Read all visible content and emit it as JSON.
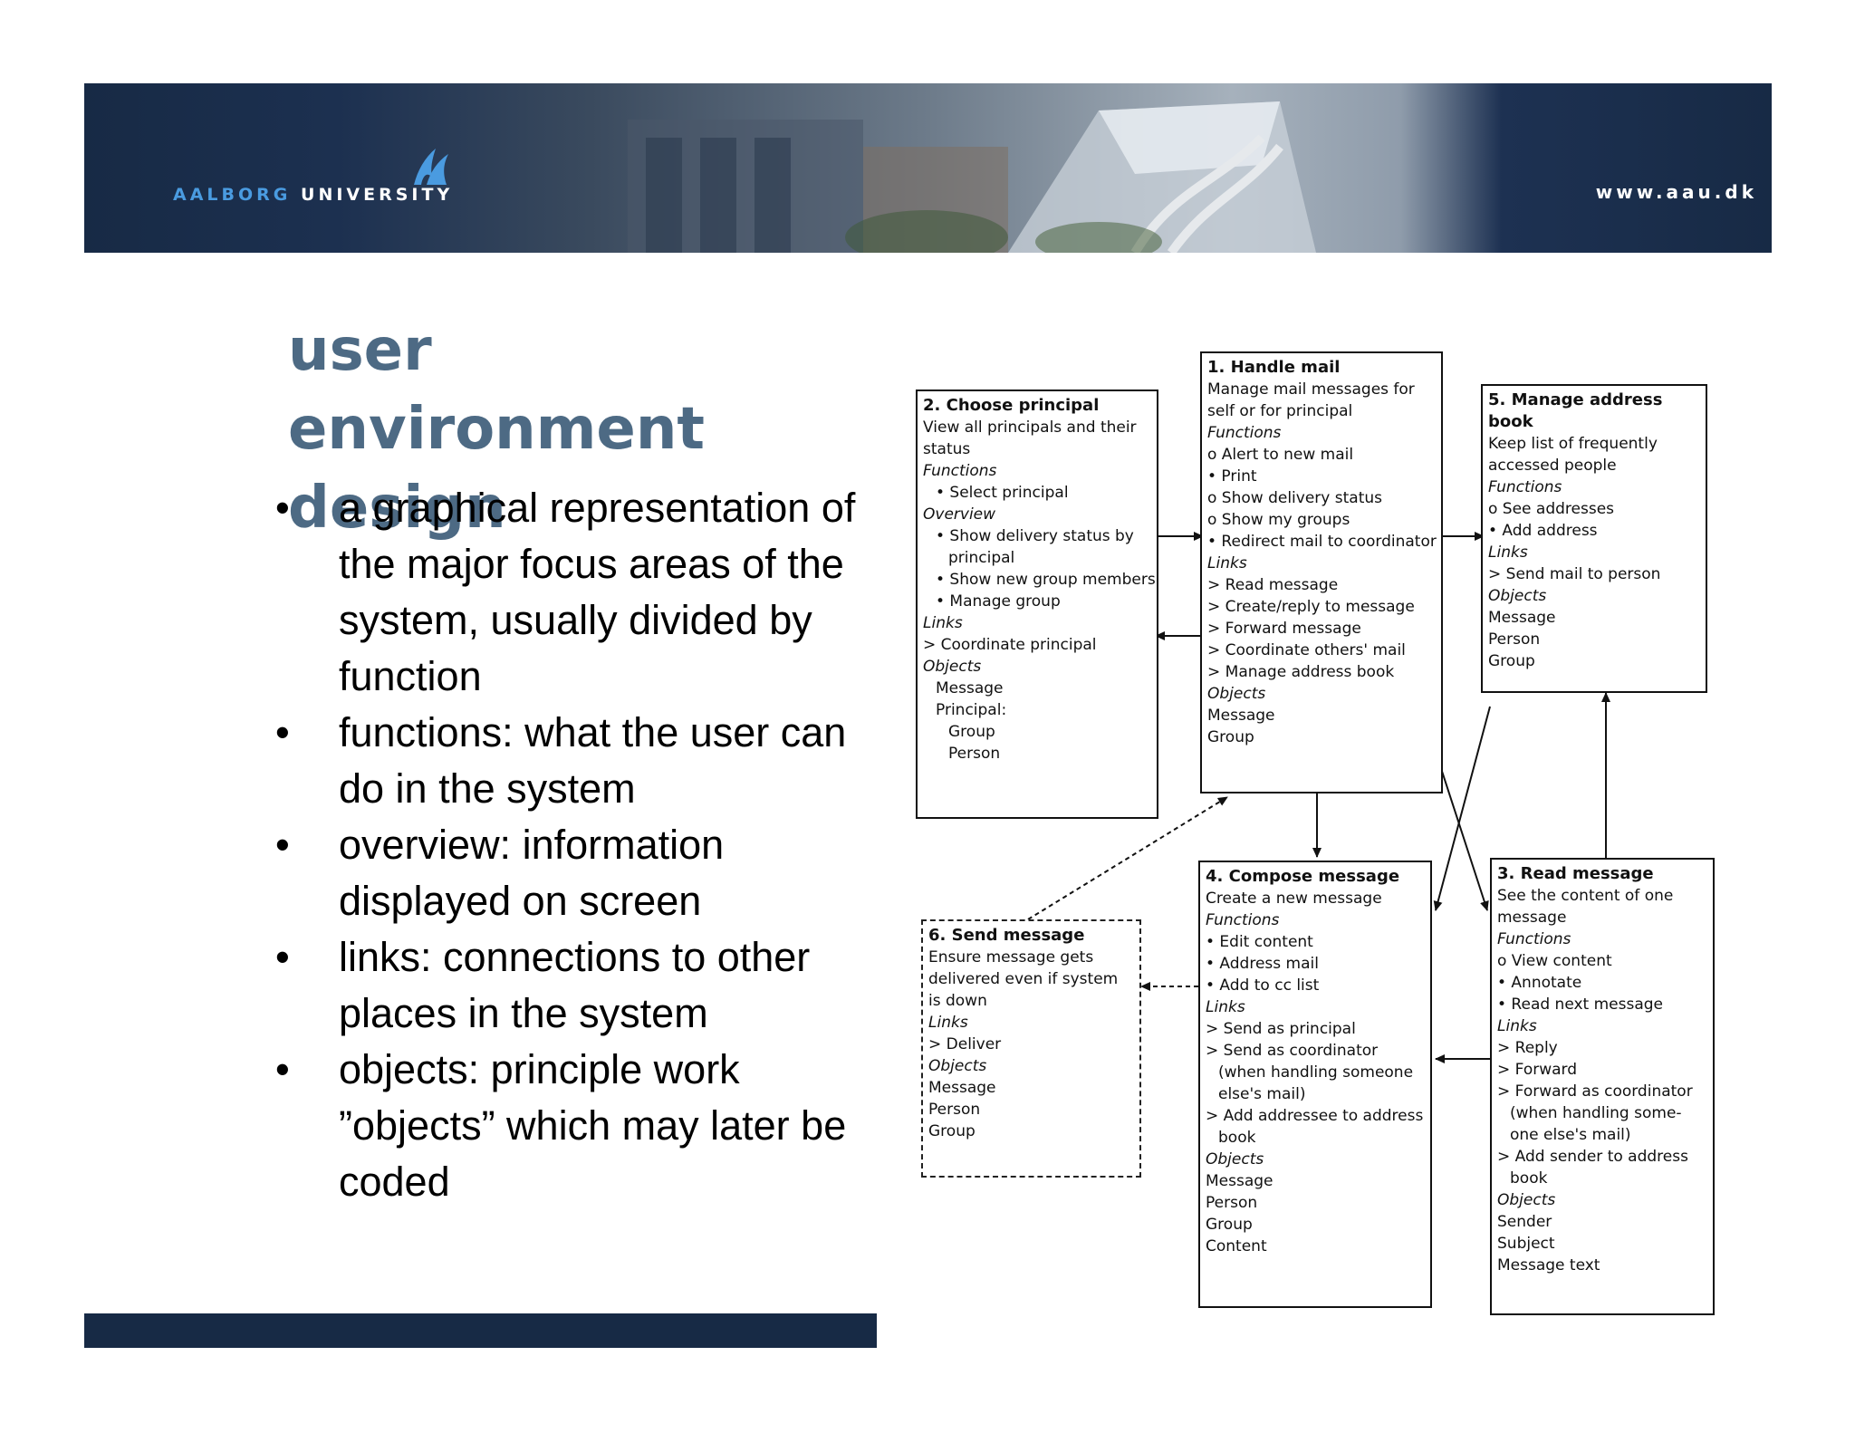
{
  "header": {
    "logo_part1": "AALBORG",
    "logo_part2": "UNIVERSITY",
    "url": "www.aau.dk"
  },
  "slide": {
    "title": "user environment design",
    "bullets": [
      "a graphical representation of the major focus areas of the system, usually divided by function",
      "functions: what the user can do in the system",
      "overview:  information displayed on screen",
      "links: connections to other places in the system",
      "objects: principle work ”objects” which may later be coded"
    ]
  },
  "diagram": {
    "boxes": [
      {
        "title": "2. Choose principal",
        "lines": [
          {
            "t": "View all principals and their"
          },
          {
            "t": "status"
          },
          {
            "t": "Functions",
            "s": "sec"
          },
          {
            "t": "• Select principal",
            "s": "ind"
          },
          {
            "t": "Overview",
            "s": "sec"
          },
          {
            "t": "• Show delivery status by",
            "s": "ind"
          },
          {
            "t": "principal",
            "s": "ind2"
          },
          {
            "t": "• Show new group members",
            "s": "ind"
          },
          {
            "t": "• Manage group",
            "s": "ind"
          },
          {
            "t": "Links",
            "s": "sec"
          },
          {
            "t": "> Coordinate principal"
          },
          {
            "t": "Objects",
            "s": "sec"
          },
          {
            "t": "Message",
            "s": "ind"
          },
          {
            "t": "Principal:",
            "s": "ind"
          },
          {
            "t": "Group",
            "s": "ind2"
          },
          {
            "t": "Person",
            "s": "ind2"
          }
        ]
      },
      {
        "title": "1. Handle mail",
        "lines": [
          {
            "t": "Manage mail messages for"
          },
          {
            "t": "self or for principal"
          },
          {
            "t": "Functions",
            "s": "sec"
          },
          {
            "t": "o Alert to new mail"
          },
          {
            "t": "• Print"
          },
          {
            "t": "o Show delivery status"
          },
          {
            "t": "o Show my groups"
          },
          {
            "t": "• Redirect mail to coordinator"
          },
          {
            "t": "Links",
            "s": "sec"
          },
          {
            "t": "> Read message"
          },
          {
            "t": "> Create/reply to message"
          },
          {
            "t": "> Forward message"
          },
          {
            "t": "> Coordinate others' mail"
          },
          {
            "t": "> Manage address book"
          },
          {
            "t": "Objects",
            "s": "sec"
          },
          {
            "t": "Message"
          },
          {
            "t": "Group"
          }
        ]
      },
      {
        "title": "5. Manage address book",
        "lines": [
          {
            "t": "Keep list of frequently"
          },
          {
            "t": "accessed people"
          },
          {
            "t": "Functions",
            "s": "sec"
          },
          {
            "t": "o See addresses"
          },
          {
            "t": "• Add address"
          },
          {
            "t": "Links",
            "s": "sec"
          },
          {
            "t": "> Send mail to person"
          },
          {
            "t": "Objects",
            "s": "sec"
          },
          {
            "t": "Message"
          },
          {
            "t": "Person"
          },
          {
            "t": "Group"
          }
        ]
      },
      {
        "title": "6. Send message",
        "lines": [
          {
            "t": "Ensure message gets"
          },
          {
            "t": "delivered even if system"
          },
          {
            "t": "is down"
          },
          {
            "t": "Links",
            "s": "sec"
          },
          {
            "t": "> Deliver"
          },
          {
            "t": "Objects",
            "s": "sec"
          },
          {
            "t": "Message"
          },
          {
            "t": "Person"
          },
          {
            "t": "Group"
          }
        ]
      },
      {
        "title": "4. Compose message",
        "lines": [
          {
            "t": "Create a new message"
          },
          {
            "t": "Functions",
            "s": "sec"
          },
          {
            "t": "• Edit content"
          },
          {
            "t": "• Address mail"
          },
          {
            "t": "• Add to cc list"
          },
          {
            "t": "Links",
            "s": "sec"
          },
          {
            "t": "> Send as principal"
          },
          {
            "t": "> Send as coordinator"
          },
          {
            "t": "(when handling someone",
            "s": "ind"
          },
          {
            "t": "else's mail)",
            "s": "ind"
          },
          {
            "t": "> Add addressee to address"
          },
          {
            "t": "book",
            "s": "ind"
          },
          {
            "t": "Objects",
            "s": "sec"
          },
          {
            "t": "Message"
          },
          {
            "t": "Person"
          },
          {
            "t": "Group"
          },
          {
            "t": "Content"
          }
        ]
      },
      {
        "title": "3. Read message",
        "lines": [
          {
            "t": "See the content of one"
          },
          {
            "t": "message"
          },
          {
            "t": "Functions",
            "s": "sec"
          },
          {
            "t": "o  View content"
          },
          {
            "t": "•  Annotate"
          },
          {
            "t": "•  Read next message"
          },
          {
            "t": "Links",
            "s": "sec"
          },
          {
            "t": "> Reply"
          },
          {
            "t": "> Forward"
          },
          {
            "t": "> Forward as coordinator"
          },
          {
            "t": "(when handling some-",
            "s": "ind"
          },
          {
            "t": "one else's mail)",
            "s": "ind"
          },
          {
            "t": "> Add sender to address"
          },
          {
            "t": "book",
            "s": "ind"
          },
          {
            "t": "Objects",
            "s": "sec"
          },
          {
            "t": "Sender"
          },
          {
            "t": "Subject"
          },
          {
            "t": "Message text"
          }
        ]
      }
    ]
  }
}
